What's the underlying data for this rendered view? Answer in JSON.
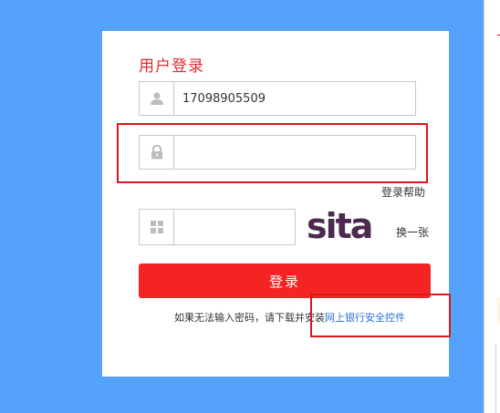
{
  "colors": {
    "background": "#55a2fb",
    "title": "#e02b2b",
    "button": "#f42424",
    "highlight": "#d61a1a",
    "link": "#2b6fd6",
    "captcha_text": "#4d2a4f"
  },
  "form": {
    "title": "用户登录",
    "username": {
      "icon": "user-icon",
      "value": "17098905509"
    },
    "password": {
      "icon": "lock-icon",
      "value": ""
    },
    "help_label": "登录帮助",
    "captcha": {
      "icon": "grid-icon",
      "value": "",
      "image_text": "sita",
      "refresh_label": "换一张"
    },
    "login_label": "登录",
    "note_text": "如果无法输入密码，请下载并安装",
    "note_link": "网上银行安全控件"
  }
}
